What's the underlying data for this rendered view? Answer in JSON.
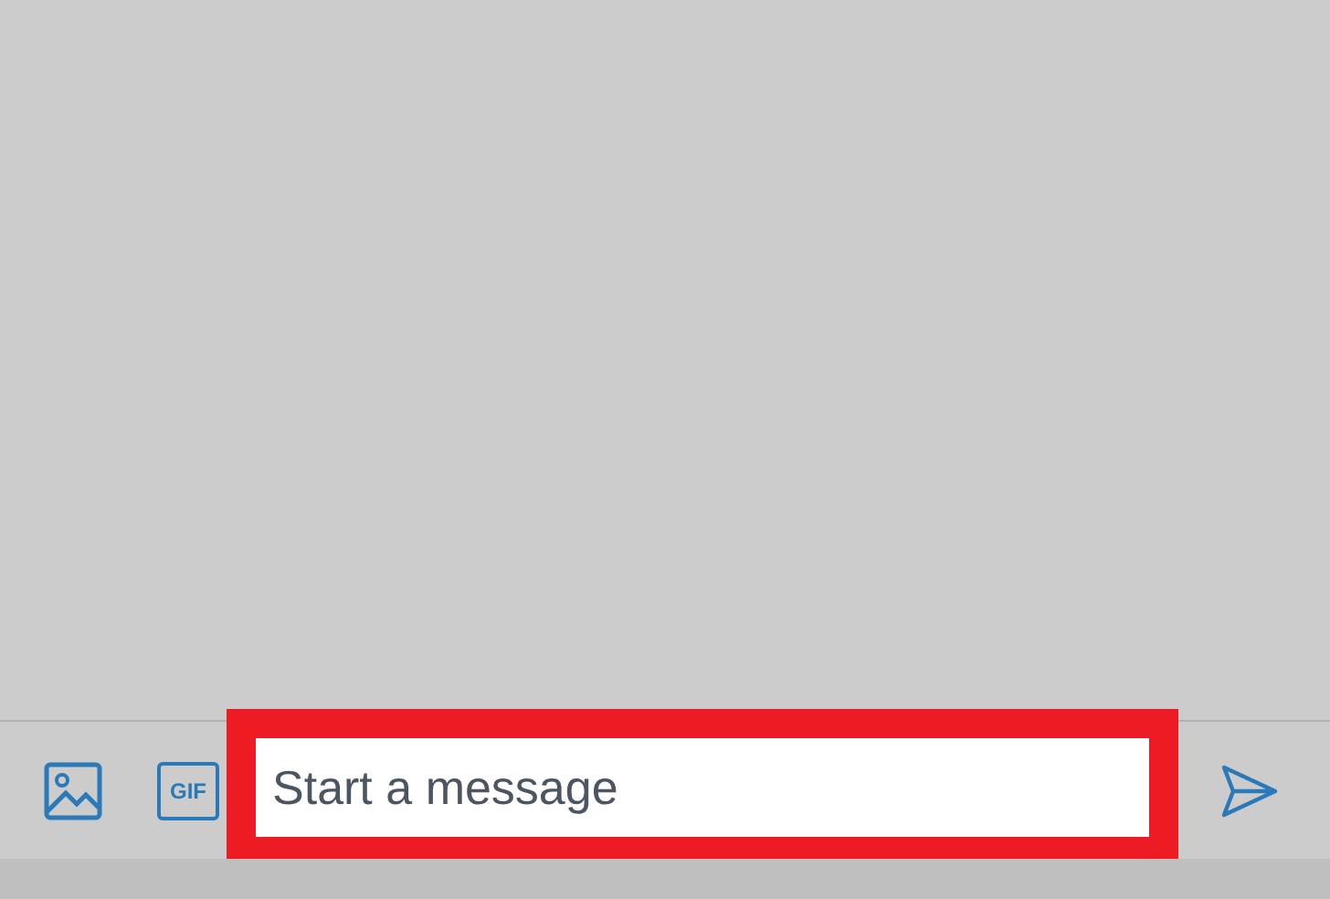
{
  "composer": {
    "gif_label": "GIF",
    "placeholder": "Start a message",
    "highlighted": true
  }
}
